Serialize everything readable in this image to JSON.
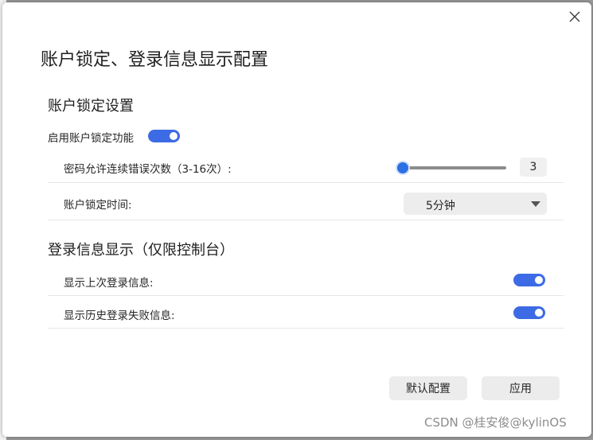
{
  "dialog": {
    "title": "账户锁定、登录信息显示配置",
    "close_icon": "close-icon"
  },
  "lock_section": {
    "title": "账户锁定设置",
    "enable_label": "启用账户锁定功能",
    "enable_on": true,
    "attempts_label": "密码允许连续错误次数（3-16次）:",
    "attempts_value": "3",
    "attempts_min": 3,
    "attempts_max": 16,
    "duration_label": "账户锁定时间:",
    "duration_value": "5分钟"
  },
  "login_section": {
    "title": "登录信息显示（仅限控制台）",
    "last_login_label": "显示上次登录信息:",
    "last_login_on": true,
    "failed_login_label": "显示历史登录失败信息:",
    "failed_login_on": true
  },
  "buttons": {
    "default_label": "默认配置",
    "apply_label": "应用"
  },
  "watermark": "CSDN @桂安俊@kylinOS",
  "colors": {
    "accent": "#3d6be5",
    "slider_handle": "#2d6fe4"
  }
}
